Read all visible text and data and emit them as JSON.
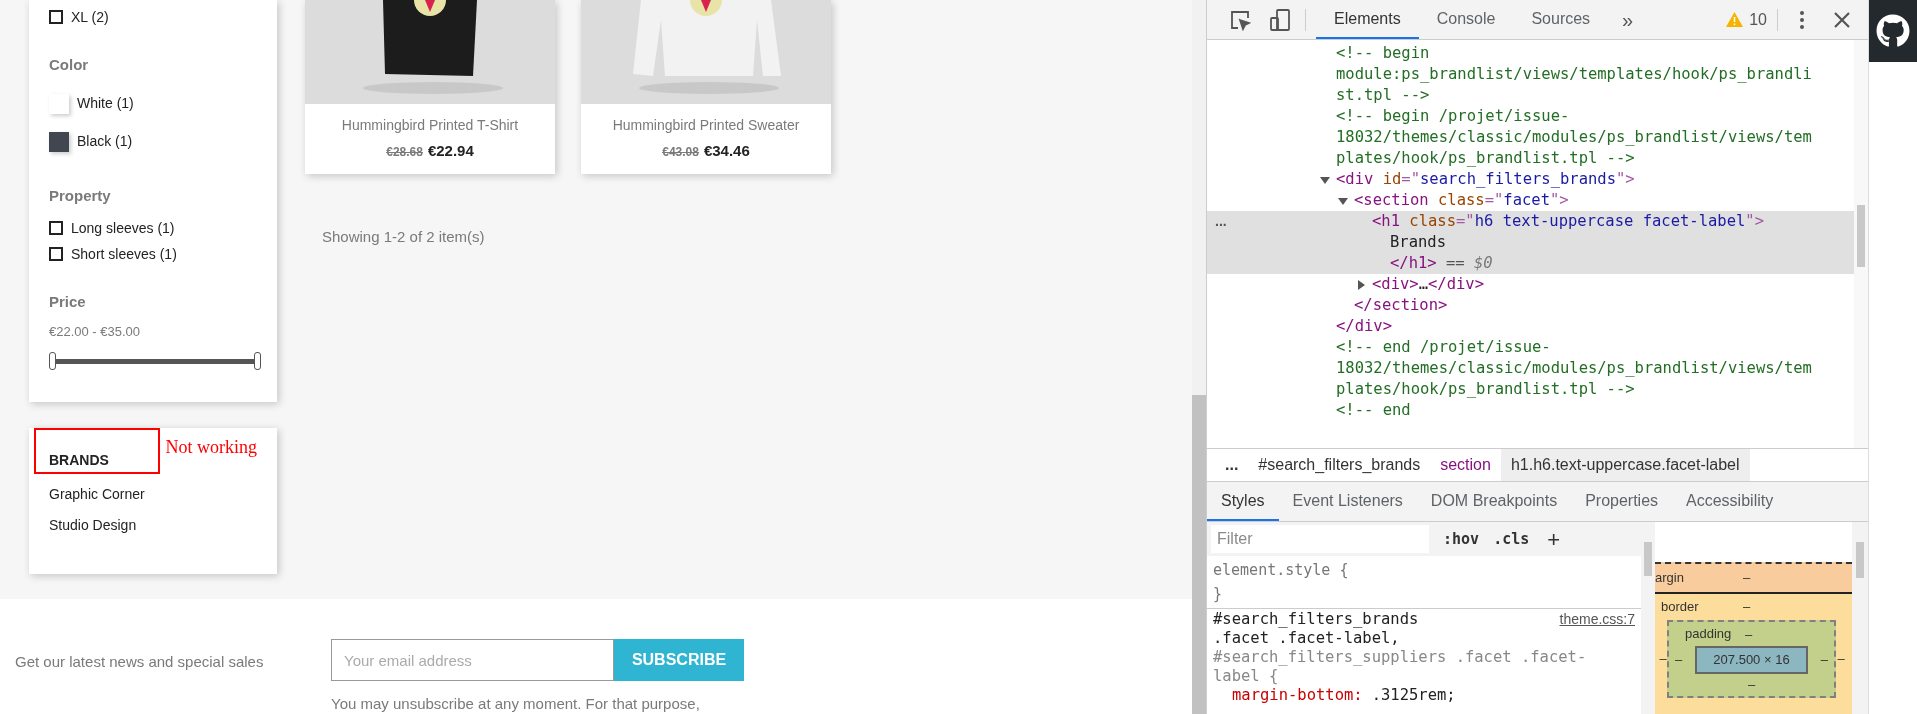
{
  "facets": [
    {
      "kind": "list",
      "options": [
        {
          "kind": "checkbox",
          "label": "XL (2)",
          "checked": false
        }
      ]
    },
    {
      "kind": "list",
      "title": "Color",
      "options": [
        {
          "kind": "swatch",
          "label": "White (1)",
          "color": "#ffffff"
        },
        {
          "kind": "swatch",
          "label": "Black (1)",
          "color": "#414651"
        }
      ]
    },
    {
      "kind": "list",
      "title": "Property",
      "options": [
        {
          "kind": "checkbox",
          "label": "Long sleeves (1)",
          "checked": false
        },
        {
          "kind": "checkbox",
          "label": "Short sleeves (1)",
          "checked": false
        }
      ]
    },
    {
      "kind": "range",
      "title": "Price",
      "range": "€22.00 - €35.00"
    }
  ],
  "brands": {
    "title": "BRANDS",
    "annotation": "Not working",
    "items": [
      "Graphic Corner",
      "Studio Design"
    ]
  },
  "products": [
    {
      "kind": "picture",
      "name": "Hummingbird Printed T-Shirt",
      "old_price": "€28.68",
      "price": "€22.94"
    },
    {
      "kind": "picture",
      "name": "Hummingbird Printed Sweater",
      "old_price": "€43.08",
      "price": "€34.46"
    }
  ],
  "results": "Showing 1-2 of 2 item(s)",
  "newsletter": {
    "text": "Get our latest news and special sales",
    "placeholder": "Your email address",
    "button": "SUBSCRIBE",
    "note": "You may unsubscribe at any moment. For that purpose,"
  },
  "devtools": {
    "tabs": [
      {
        "label": "Elements",
        "selected": true
      },
      {
        "label": "Console",
        "selected": false
      },
      {
        "label": "Sources",
        "selected": false
      }
    ],
    "more": "»",
    "warnings": "10",
    "dom_tree": [
      {
        "kind": "comment",
        "lines": [
          "<!-- begin",
          "module:ps_brandlist/views/templates/hook/ps_brandli",
          "st.tpl -->"
        ]
      },
      {
        "kind": "comment",
        "lines": [
          "<!-- begin /projet/issue-",
          "18032/themes/classic/modules/ps_brandlist/views/tem",
          "plates/hook/ps_brandlist.tpl -->"
        ]
      },
      {
        "kind": "element",
        "expanded": true,
        "selected": false,
        "open": [
          {
            "kind": "tag",
            "text": "<div"
          },
          {
            "kind": "attr",
            "text": " id"
          },
          {
            "kind": "punct",
            "text": "=\""
          },
          {
            "kind": "value",
            "text": "search_filters_brands"
          },
          {
            "kind": "punct",
            "text": "\">"
          }
        ],
        "close": [
          {
            "kind": "tag",
            "text": "</div>"
          }
        ],
        "children": [
          {
            "kind": "element",
            "expanded": true,
            "selected": false,
            "open": [
              {
                "kind": "tag",
                "text": "<section"
              },
              {
                "kind": "attr",
                "text": " class"
              },
              {
                "kind": "punct",
                "text": "=\""
              },
              {
                "kind": "value",
                "text": "facet"
              },
              {
                "kind": "punct",
                "text": "\">"
              }
            ],
            "close": [
              {
                "kind": "tag",
                "text": "</section>"
              }
            ],
            "children": [
              {
                "kind": "element",
                "selected": true,
                "gutter": "...",
                "open": [
                  {
                    "kind": "tag",
                    "text": "<h1"
                  },
                  {
                    "kind": "attr",
                    "text": " class"
                  },
                  {
                    "kind": "punct",
                    "text": "=\""
                  },
                  {
                    "kind": "value",
                    "text": "h6 text-uppercase facet-label"
                  },
                  {
                    "kind": "punct",
                    "text": "\">"
                  }
                ],
                "close": [
                  {
                    "kind": "tag",
                    "text": "</h1>"
                  },
                  {
                    "kind": "eq",
                    "text": " == "
                  },
                  {
                    "kind": "var",
                    "text": "$0"
                  }
                ],
                "children": [
                  {
                    "kind": "text",
                    "lines": [
                      "Brands"
                    ]
                  }
                ]
              },
              {
                "kind": "element",
                "expanded": false,
                "selected": false,
                "open": [
                  {
                    "kind": "tag",
                    "text": "<div>"
                  },
                  {
                    "kind": "text",
                    "text": "…"
                  },
                  {
                    "kind": "tag",
                    "text": "</div>"
                  }
                ]
              }
            ]
          }
        ]
      },
      {
        "kind": "comment",
        "lines": [
          "<!-- end /projet/issue-",
          "18032/themes/classic/modules/ps_brandlist/views/tem",
          "plates/hook/ps_brandlist.tpl -->"
        ]
      },
      {
        "kind": "comment",
        "lines": [
          "<!-- end"
        ]
      }
    ],
    "breadcrumb": [
      {
        "label": "...",
        "kind": "more",
        "selected": false
      },
      {
        "label": "#search_filters_brands",
        "kind": "id",
        "selected": false
      },
      {
        "label": "section",
        "kind": "tag",
        "selected": false
      },
      {
        "label": "h1.h6.text-uppercase.facet-label",
        "kind": "id",
        "selected": true
      }
    ],
    "subtabs": [
      {
        "label": "Styles",
        "selected": true
      },
      {
        "label": "Event Listeners",
        "selected": false
      },
      {
        "label": "DOM Breakpoints",
        "selected": false
      },
      {
        "label": "Properties",
        "selected": false
      },
      {
        "label": "Accessibility",
        "selected": false
      }
    ],
    "filter": {
      "placeholder": "Filter",
      "hov": ":hov",
      "cls": ".cls",
      "add": "+"
    },
    "element_style": [
      "element.style {",
      "}"
    ],
    "rule": {
      "selectors": [
        {
          "text": "#search_filters_brands",
          "matched": true
        },
        {
          "text": ".facet .facet-label,",
          "matched": true
        },
        {
          "text": "#search_filters_suppliers .facet .facet-",
          "matched": false
        },
        {
          "text": "label {",
          "matched": false
        }
      ],
      "source": "theme.css:7",
      "declaration": {
        "name": "margin-bottom:",
        "value": ".3125rem;"
      }
    },
    "box_model": {
      "margin_label": "argin",
      "margin_top": "–",
      "border_label": "border",
      "border_top": "–",
      "border_left": "–",
      "border_right": "–",
      "padding_label": "padding",
      "padding_top": "–",
      "padding_left": "–",
      "padding_right": "–",
      "padding_bottom": "–",
      "content": "207.500 × 16"
    }
  }
}
